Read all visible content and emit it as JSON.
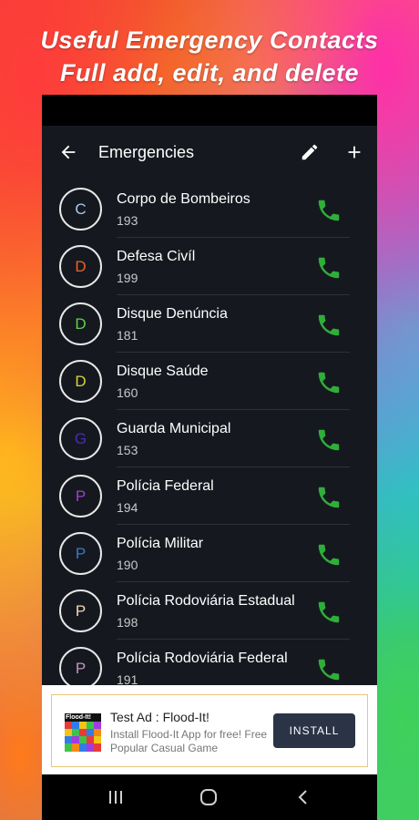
{
  "promo": {
    "line1": "Useful Emergency Contacts",
    "line2": "Full add, edit, and delete"
  },
  "app_bar": {
    "title": "Emergencies",
    "back_icon": "arrow-back-icon",
    "edit_icon": "pencil-icon",
    "add_icon": "plus-icon"
  },
  "contacts": [
    {
      "initial": "C",
      "name": "Corpo de Bombeiros",
      "number": "193",
      "color": "#a9c9ee"
    },
    {
      "initial": "D",
      "name": "Defesa Civíl",
      "number": "199",
      "color": "#e8622c"
    },
    {
      "initial": "D",
      "name": "Disque Denúncia",
      "number": "181",
      "color": "#5fd04a"
    },
    {
      "initial": "D",
      "name": "Disque Saúde",
      "number": "160",
      "color": "#d6d33a"
    },
    {
      "initial": "G",
      "name": "Guarda Municipal",
      "number": "153",
      "color": "#4b2bb8"
    },
    {
      "initial": "P",
      "name": "Polícia Federal",
      "number": "194",
      "color": "#a040c8"
    },
    {
      "initial": "P",
      "name": "Polícia Militar",
      "number": "190",
      "color": "#3a78c8"
    },
    {
      "initial": "P",
      "name": "Polícia Rodoviária Estadual",
      "number": "198",
      "color": "#f0d8b8"
    },
    {
      "initial": "P",
      "name": "Polícia Rodoviária Federal",
      "number": "191",
      "color": "#c890c0"
    }
  ],
  "call_icon": "phone-icon",
  "call_color": "#2fae3a",
  "ad": {
    "logo_text": "Flood-It!",
    "title": "Test Ad : Flood-It!",
    "body": "Install Flood-It App for free! Free Popular Casual Game",
    "install_label": "INSTALL"
  },
  "nav": {
    "recents_icon": "recents-icon",
    "home_icon": "home-icon",
    "back_icon": "nav-back-icon"
  }
}
